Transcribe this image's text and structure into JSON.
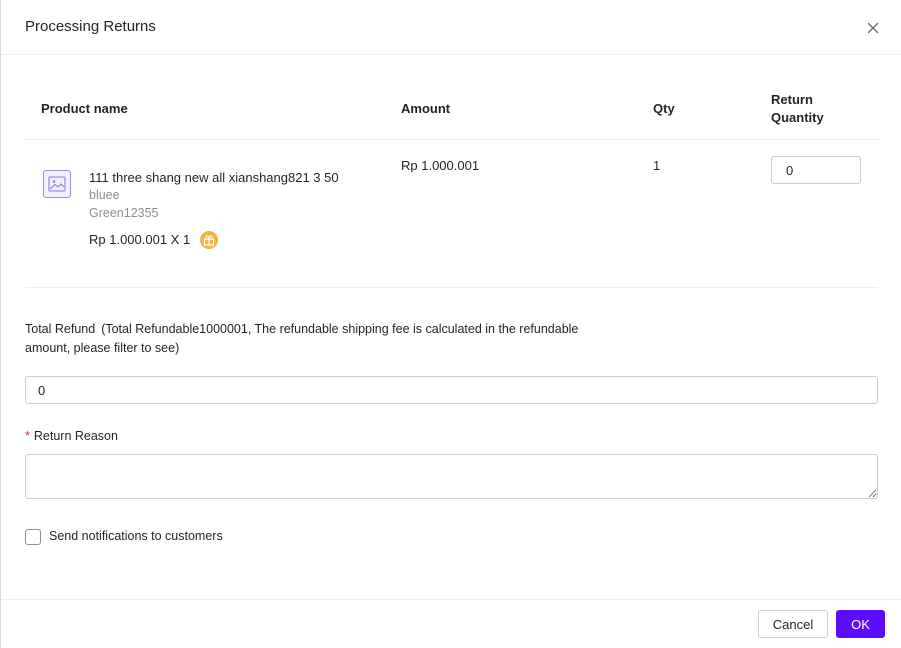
{
  "modal": {
    "title": "Processing Returns"
  },
  "table": {
    "headers": {
      "product_name": "Product name",
      "amount": "Amount",
      "qty": "Qty",
      "return_quantity": "Return Quantity"
    },
    "rows": [
      {
        "name": "111 three shang new all xianshang821 3 50",
        "variant": "bluee",
        "sku": "Green12355",
        "price_line": "Rp 1.000.001 X 1",
        "amount": "Rp 1.000.001",
        "qty": "1",
        "return_quantity": "0"
      }
    ]
  },
  "refund": {
    "label": "Total Refund",
    "note": "(Total Refundable1000001, The refundable shipping fee is calculated in the refundable amount, please filter to see)",
    "value": "0"
  },
  "reason": {
    "required_mark": "*",
    "label": "Return Reason",
    "value": ""
  },
  "notify": {
    "label": "Send notifications to customers",
    "checked": false
  },
  "footer": {
    "cancel_label": "Cancel",
    "ok_label": "OK"
  },
  "colors": {
    "primary": "#5b0cff",
    "gift_badge": "#f5b342",
    "required": "#f5222d"
  },
  "icons": {
    "close": "close-icon",
    "product_image": "image-placeholder-icon",
    "gift": "gift-icon"
  }
}
